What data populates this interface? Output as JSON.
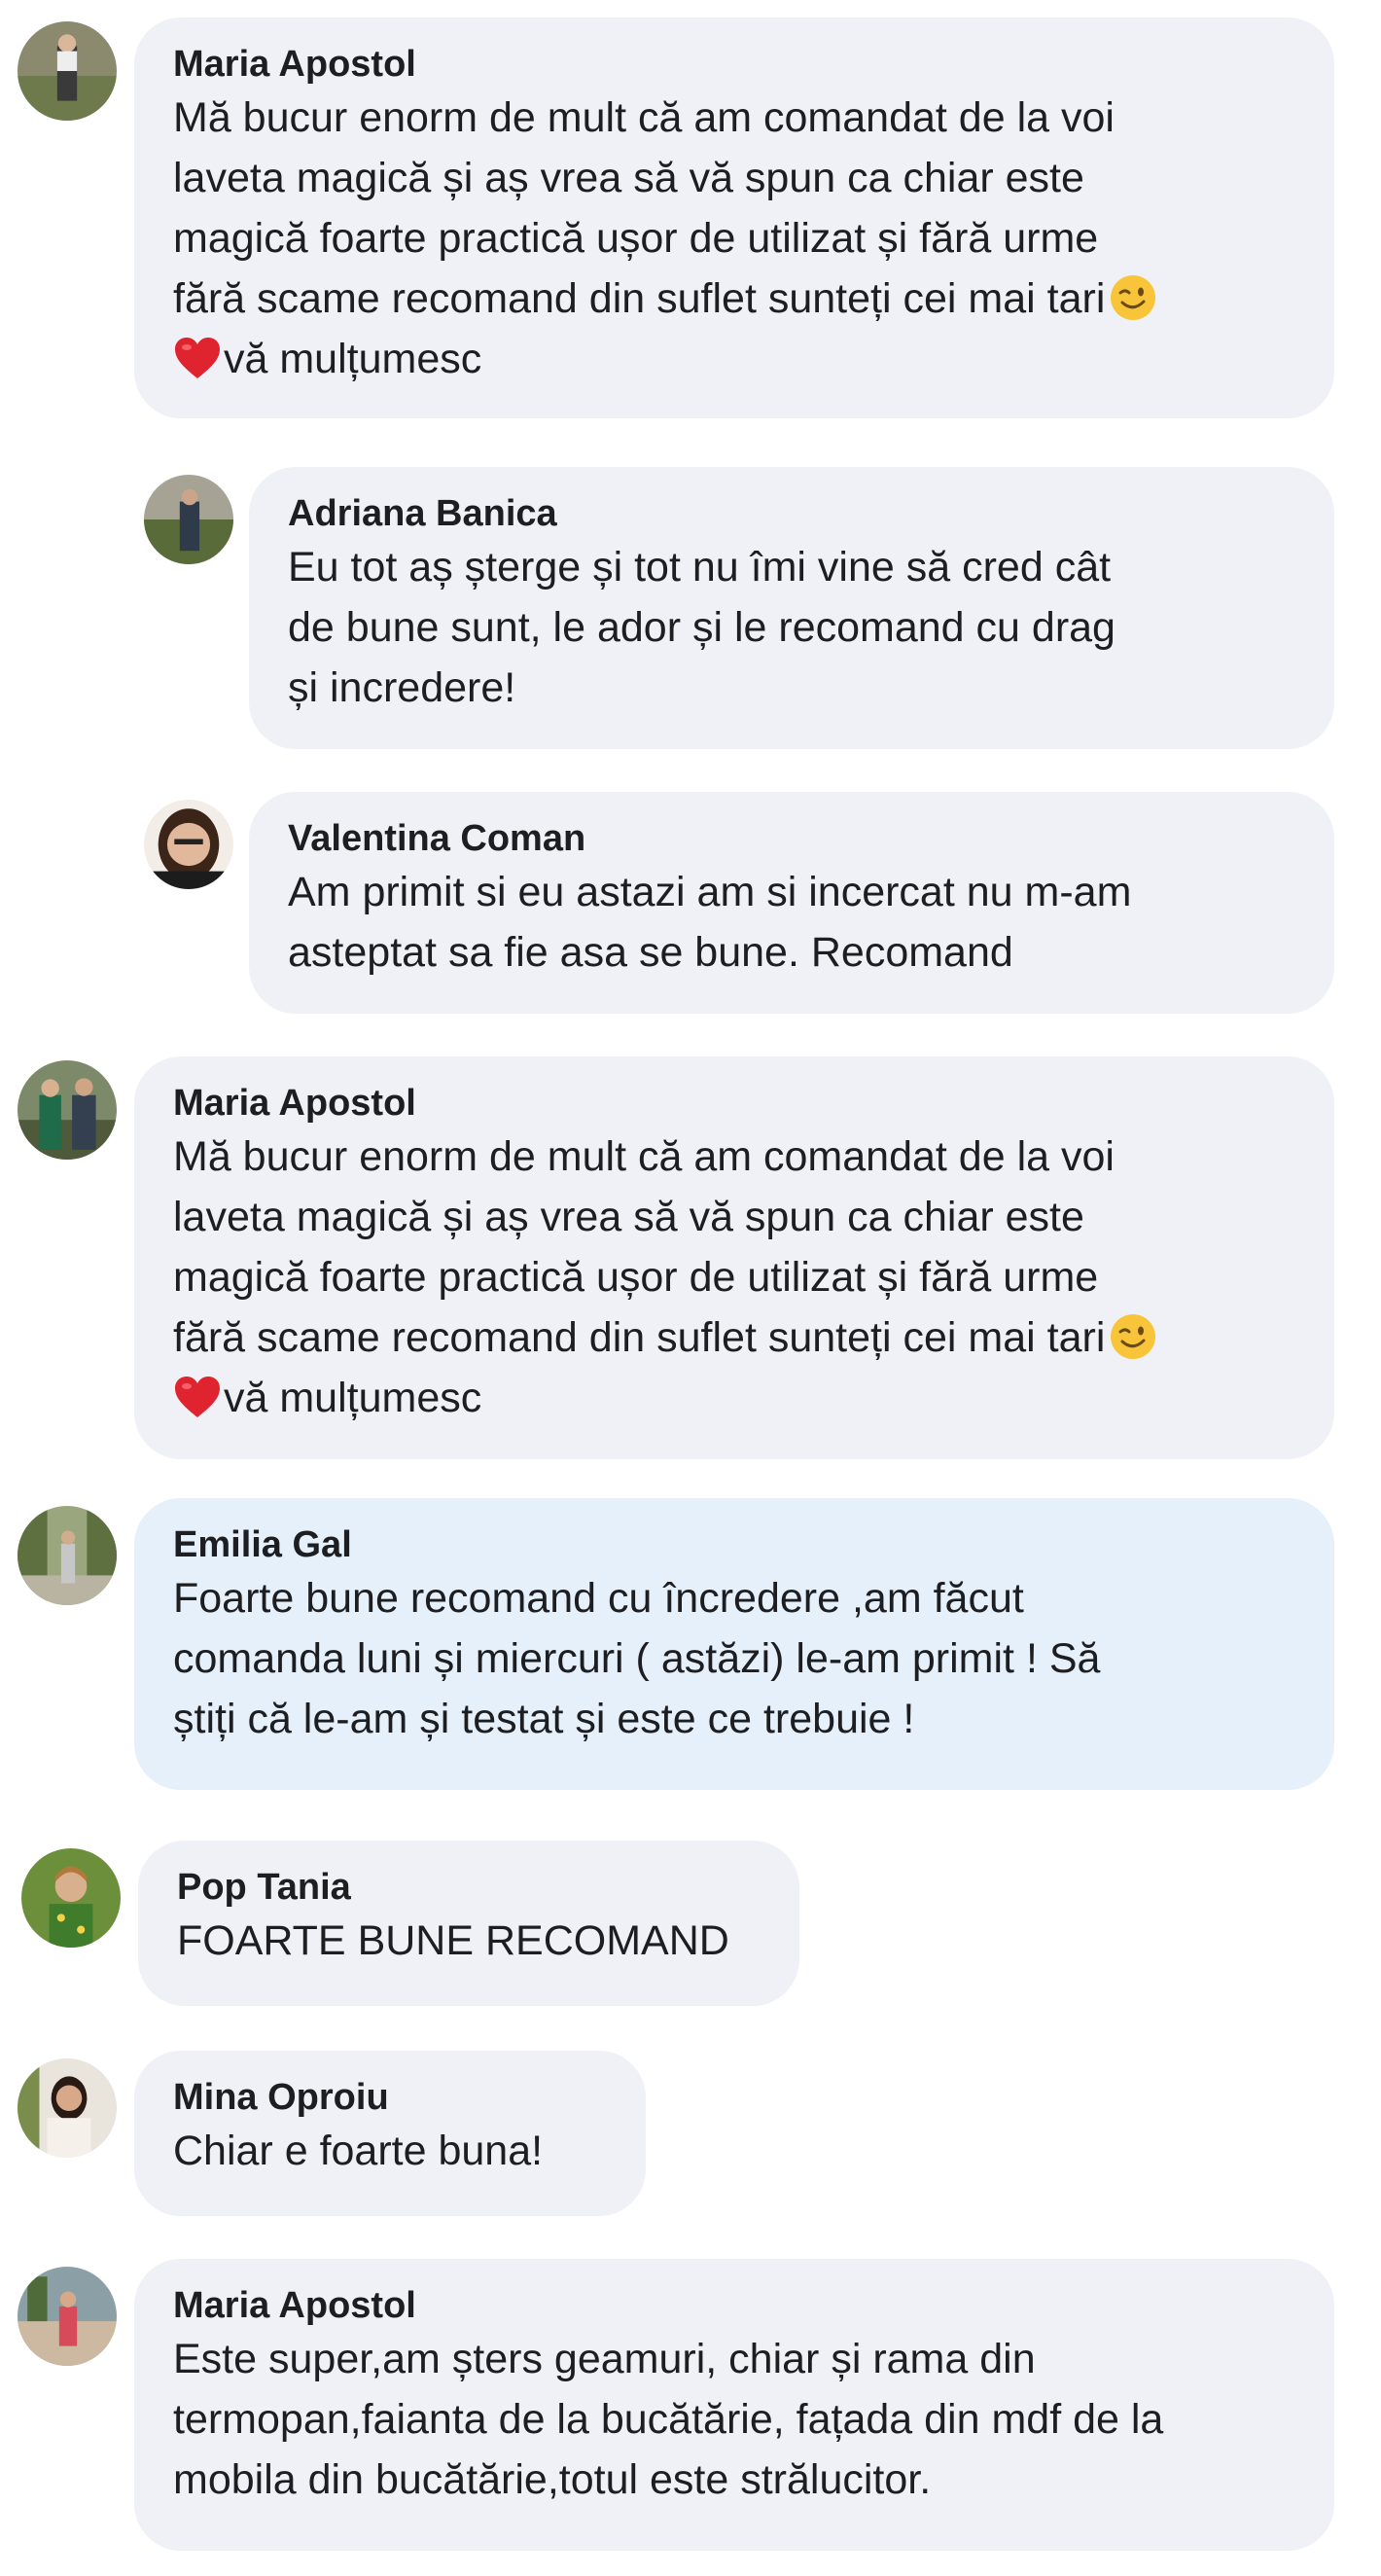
{
  "comments": [
    {
      "author": "Maria Apostol",
      "lines": [
        "Mă bucur enorm de mult că am comandat de la voi",
        "laveta magică și aș vrea să vă spun ca chiar este",
        "magică foarte practică ușor de utilizat și fără urme",
        "fără scame recomand din suflet sunteți cei mai tari",
        "vă mulțumesc"
      ],
      "emoji_after_line4": "winking-face-emoji",
      "emoji_before_line5": "red-heart-emoji"
    },
    {
      "author": "Adriana Banica",
      "lines": [
        "Eu tot aș șterge și tot nu îmi vine să cred cât",
        "de bune sunt, le ador și le recomand cu drag",
        "și incredere!"
      ]
    },
    {
      "author": "Valentina Coman",
      "lines": [
        "Am primit si eu astazi am si incercat nu m-am",
        "asteptat sa fie asa se bune. Recomand"
      ]
    },
    {
      "author": "Maria Apostol",
      "lines": [
        "Mă bucur enorm de mult că am comandat de la voi",
        "laveta magică și aș vrea să vă spun ca chiar este",
        "magică foarte practică ușor de utilizat și fără urme",
        "fără scame recomand din suflet sunteți cei mai tari",
        "vă mulțumesc"
      ],
      "emoji_after_line4": "winking-face-emoji",
      "emoji_before_line5": "red-heart-emoji"
    },
    {
      "author": "Emilia Gal",
      "lines": [
        "Foarte bune recomand cu încredere ,am făcut",
        "comanda luni și miercuri ( astăzi) le-am primit ! Să",
        "știți că le-am și testat și este ce trebuie !"
      ]
    },
    {
      "author": "Pop Tania",
      "lines": [
        "FOARTE BUNE RECOMAND"
      ]
    },
    {
      "author": "Mina Oproiu",
      "lines": [
        "Chiar e foarte buna!"
      ]
    },
    {
      "author": "Maria Apostol",
      "lines": [
        "Este super,am șters geamuri, chiar și rama din",
        "termopan,faianta de la bucătărie, fațada din mdf de la",
        "mobila din bucătărie,totul este strălucitor."
      ]
    }
  ],
  "colors": {
    "bubble": "#f0f1f6",
    "bubble_highlight": "#e6f0fb",
    "text": "#1c1e21"
  }
}
